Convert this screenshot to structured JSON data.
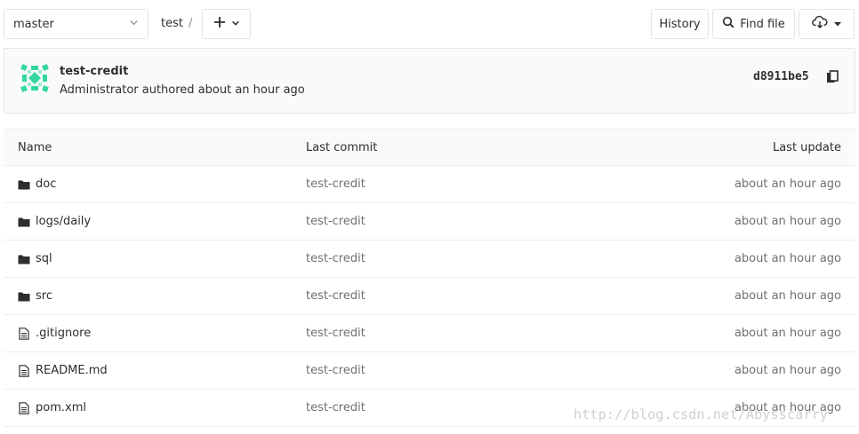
{
  "toolbar": {
    "branch": "master",
    "breadcrumb": [
      "test"
    ],
    "breadcrumb_separator": "/",
    "history_label": "History",
    "find_file_label": "Find file"
  },
  "commit": {
    "title": "test-credit",
    "meta": "Administrator authored about an hour ago",
    "sha": "d8911be5"
  },
  "table": {
    "headers": {
      "name": "Name",
      "last_commit": "Last commit",
      "last_update": "Last update"
    },
    "rows": [
      {
        "name": "doc",
        "type": "folder",
        "commit": "test-credit",
        "updated": "about an hour ago"
      },
      {
        "name": "logs/daily",
        "type": "folder",
        "commit": "test-credit",
        "updated": "about an hour ago"
      },
      {
        "name": "sql",
        "type": "folder",
        "commit": "test-credit",
        "updated": "about an hour ago"
      },
      {
        "name": "src",
        "type": "folder",
        "commit": "test-credit",
        "updated": "about an hour ago"
      },
      {
        "name": ".gitignore",
        "type": "file",
        "commit": "test-credit",
        "updated": "about an hour ago"
      },
      {
        "name": "README.md",
        "type": "file",
        "commit": "test-credit",
        "updated": "about an hour ago"
      },
      {
        "name": "pom.xml",
        "type": "file",
        "commit": "test-credit",
        "updated": "about an hour ago"
      }
    ]
  },
  "watermark": "http://blog.csdn.net/Abysscarry",
  "colors": {
    "avatar_accent": "#35d6a0",
    "border": "#e5e5e5",
    "panel_bg": "#fafafa",
    "muted_text": "#707070"
  }
}
